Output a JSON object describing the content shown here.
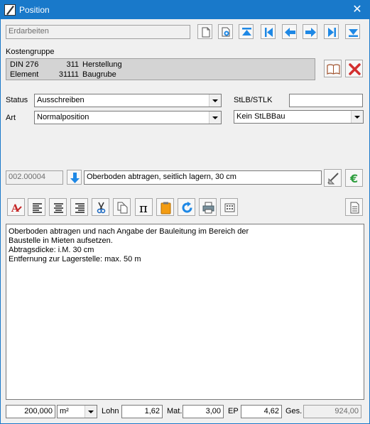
{
  "window": {
    "title": "Position",
    "close_icon": "close-icon"
  },
  "header": {
    "parent_field": "Erdarbeiten"
  },
  "kostengruppe": {
    "label": "Kostengruppe",
    "rows": [
      {
        "a": "DIN 276",
        "b": "311",
        "c": "Herstellung"
      },
      {
        "a": "Element",
        "b": "31111",
        "c": "Baugrube"
      }
    ]
  },
  "status": {
    "label": "Status",
    "value": "Ausschreiben"
  },
  "art": {
    "label": "Art",
    "value": "Normalposition"
  },
  "stlb": {
    "label": "StLB/STLK",
    "value": "",
    "combo_value": "Kein StLBBau"
  },
  "position": {
    "number": "002.00004",
    "short_text": "Oberboden abtragen, seitlich lagern, 30 cm"
  },
  "longtext": {
    "lines": [
      "Oberboden abtragen und nach Angabe der Bauleitung im Bereich der",
      "Baustelle in Mieten aufsetzen.",
      "Abtragsdicke: i.M. 30 cm",
      "Entfernung zur Lagerstelle: max. 50 m"
    ]
  },
  "footer": {
    "quantity": "200,000",
    "unit": "m²",
    "lohn_label": "Lohn",
    "lohn_value": "1,62",
    "mat_label": "Mat.",
    "mat_value": "3,00",
    "ep_label": "EP",
    "ep_value": "4,62",
    "ges_label": "Ges.",
    "ges_value": "924,00"
  },
  "colors": {
    "titlebar": "#1979ca",
    "nav_blue": "#1e88e5",
    "delete_red": "#d32f2f",
    "euro_green": "#2e9e3e"
  }
}
